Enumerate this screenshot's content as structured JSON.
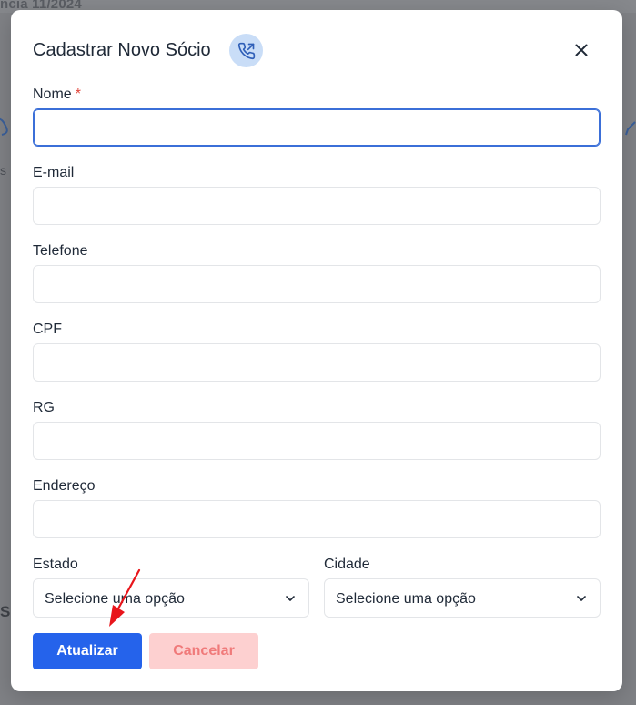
{
  "background": {
    "top_text": "ncia 11/2024",
    "side_letter": "s",
    "side_s": "S"
  },
  "modal": {
    "title": "Cadastrar Novo Sócio",
    "title_icon": "phone-outgoing-icon",
    "close_icon": "close-icon"
  },
  "form": {
    "nome": {
      "label": "Nome",
      "required_mark": "*",
      "value": "",
      "placeholder": ""
    },
    "email": {
      "label": "E-mail",
      "value": "",
      "placeholder": ""
    },
    "telefone": {
      "label": "Telefone",
      "value": "",
      "placeholder": ""
    },
    "cpf": {
      "label": "CPF",
      "value": "",
      "placeholder": ""
    },
    "rg": {
      "label": "RG",
      "value": "",
      "placeholder": ""
    },
    "endereco": {
      "label": "Endereço",
      "value": "",
      "placeholder": ""
    },
    "estado": {
      "label": "Estado",
      "selected": "Selecione uma opção"
    },
    "cidade": {
      "label": "Cidade",
      "selected": "Selecione uma opção"
    }
  },
  "actions": {
    "submit_label": "Atualizar",
    "cancel_label": "Cancelar"
  },
  "colors": {
    "primary": "#2563eb",
    "cancel_bg": "#fdd0d0",
    "cancel_text": "#f07a7a",
    "required": "#e0453a",
    "annotation_arrow": "#e8151b"
  }
}
